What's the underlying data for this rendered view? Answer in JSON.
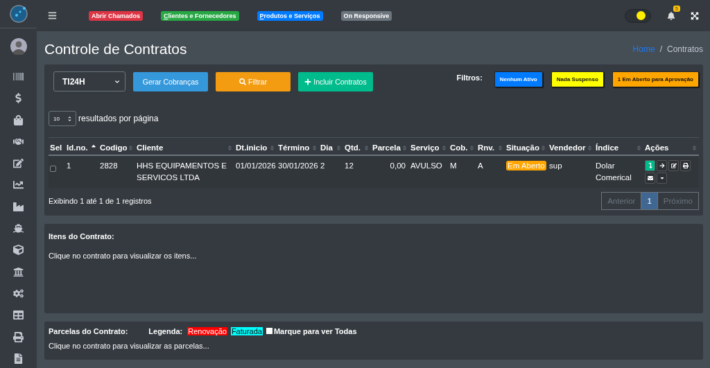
{
  "navbar": {
    "shortcuts": [
      {
        "label": "Abrir Chamados",
        "color": "#dc3545",
        "underline_first": false
      },
      {
        "label": "Clientes e Fornecedores",
        "color": "#28a745",
        "underline_first": true
      },
      {
        "label": "Produtos e Serviços",
        "color": "#007bff",
        "underline_first": true
      },
      {
        "label": "On Responsive",
        "color": "#6c757d",
        "underline_first": false
      }
    ],
    "theme_toggle": {
      "on": true
    },
    "notifications": {
      "count": "5"
    }
  },
  "page": {
    "title": "Controle de Contratos",
    "breadcrumb": [
      {
        "label": "Home",
        "kind": "link"
      },
      {
        "label": "Contratos",
        "kind": "current"
      }
    ],
    "breadcrumb_separator": "/"
  },
  "toolbar": {
    "company_select": {
      "value": "TI24H"
    },
    "buttons": [
      {
        "label": "Gerar Cobranças",
        "color": "#3498db",
        "kind": "plain"
      },
      {
        "label": "Filtrar",
        "color": "#f39c12",
        "kind": "search"
      },
      {
        "label": "Incluir Contratos",
        "color": "#00bc8c",
        "kind": "add"
      }
    ],
    "filters_label": "Filtros:",
    "filters": [
      {
        "label": "Nenhum Ativo",
        "color": "#007bff"
      },
      {
        "label": "Nada Suspenso",
        "color": "#ffff00"
      },
      {
        "label": "1 Em Aberto para Aprovação",
        "color": "#ffa500"
      }
    ]
  },
  "page_size": {
    "value": "10",
    "label": "resultados por página"
  },
  "table": {
    "columns": [
      {
        "label": "Sel",
        "sortable": false
      },
      {
        "label": "Id.no.",
        "sortable": true,
        "sorted": true
      },
      {
        "label": "Codigo",
        "sortable": true,
        "sorted": false
      },
      {
        "label": "Cliente",
        "sortable": true,
        "sorted": false
      },
      {
        "label": "Dt.inicio",
        "sortable": true,
        "sorted": false
      },
      {
        "label": "Término",
        "sortable": true,
        "sorted": false
      },
      {
        "label": "Dia",
        "sortable": true,
        "sorted": false
      },
      {
        "label": "Qtd.",
        "sortable": true,
        "sorted": false
      },
      {
        "label": "Parcela",
        "sortable": true,
        "sorted": false
      },
      {
        "label": "Serviço",
        "sortable": true,
        "sorted": false
      },
      {
        "label": "Cob.",
        "sortable": true,
        "sorted": false
      },
      {
        "label": "Rnv.",
        "sortable": true,
        "sorted": false
      },
      {
        "label": "Situação",
        "sortable": true,
        "sorted": false
      },
      {
        "label": "Vendedor",
        "sortable": true,
        "sorted": false
      },
      {
        "label": "Índice",
        "sortable": true,
        "sorted": false
      },
      {
        "label": "Ações",
        "sortable": true,
        "sorted": false
      }
    ],
    "rows": [
      {
        "checked": false,
        "id": "1",
        "codigo": "2828",
        "cliente": "HHS EQUIPAMENTOS E SERVICOS LTDA",
        "inicio": "01/01/2026",
        "termino": "30/01/2026",
        "dia": "2",
        "qtd": "12",
        "parcela": "0,00",
        "servico": "AVULSO",
        "cob": "M",
        "rnv": "A",
        "situacao": "Em Aberto",
        "vendedor": "sup",
        "indice": "Dolar Comerical"
      }
    ]
  },
  "table_info": "Exibindo 1 até 1 de 1 registros",
  "pagination": [
    {
      "label": "Anterior",
      "disabled": true,
      "selected": false
    },
    {
      "label": "1",
      "disabled": false,
      "selected": true
    },
    {
      "label": "Próximo",
      "disabled": true,
      "selected": false
    }
  ],
  "items_panel": {
    "title": "Itens do Contrato:",
    "message": "Clique no contrato para visualizar os itens..."
  },
  "installments_panel": {
    "title": "Parcelas do Contrato:",
    "legend_label": "Legenda:",
    "legend": [
      {
        "label": "Renovação",
        "color": "#ff0000"
      },
      {
        "label": "Faturada",
        "color": "#00ffff"
      }
    ],
    "show_all": {
      "label": "Marque para ver Todas",
      "checked": false
    },
    "message": "Clique no contrato para visualizar as parcelas..."
  }
}
